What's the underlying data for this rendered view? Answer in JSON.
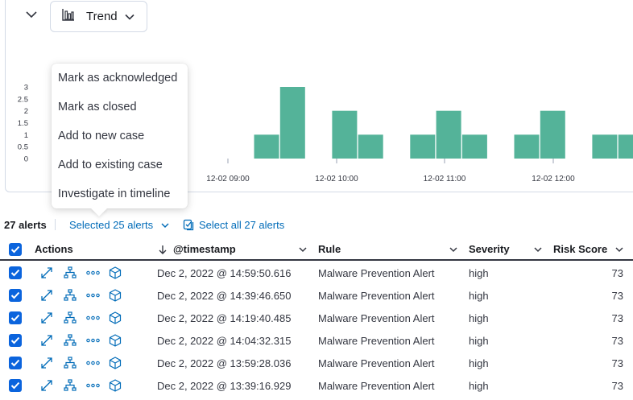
{
  "toolbar": {
    "trend_label": "Trend"
  },
  "chart_data": {
    "type": "bar",
    "y_ticks": [
      "3",
      "2.5",
      "2",
      "1.5",
      "1",
      "0.5",
      "0"
    ],
    "x_ticks": [
      "12-02 09:00",
      "12-02 10:00",
      "12-02 11:00",
      "12-02 12:00"
    ],
    "ylim": [
      0,
      3
    ],
    "values": [
      1,
      3,
      0,
      2,
      1,
      0,
      1,
      2,
      1,
      0,
      1,
      2,
      0,
      1,
      1
    ],
    "color": "#54b399"
  },
  "context_menu": {
    "items": [
      "Mark as acknowledged",
      "Mark as closed",
      "Add to new case",
      "Add to existing case",
      "Investigate in timeline"
    ]
  },
  "alerts_bar": {
    "count": "27 alerts",
    "selected": "Selected 25 alerts",
    "select_all": "Select all 27 alerts"
  },
  "table": {
    "columns": {
      "actions": "Actions",
      "timestamp": "@timestamp",
      "rule": "Rule",
      "severity": "Severity",
      "risk": "Risk Score"
    },
    "rows": [
      {
        "timestamp": "Dec 2, 2022 @ 14:59:50.616",
        "rule": "Malware Prevention Alert",
        "severity": "high",
        "risk": "73"
      },
      {
        "timestamp": "Dec 2, 2022 @ 14:39:46.650",
        "rule": "Malware Prevention Alert",
        "severity": "high",
        "risk": "73"
      },
      {
        "timestamp": "Dec 2, 2022 @ 14:19:40.485",
        "rule": "Malware Prevention Alert",
        "severity": "high",
        "risk": "73"
      },
      {
        "timestamp": "Dec 2, 2022 @ 14:04:32.315",
        "rule": "Malware Prevention Alert",
        "severity": "high",
        "risk": "73"
      },
      {
        "timestamp": "Dec 2, 2022 @ 13:59:28.036",
        "rule": "Malware Prevention Alert",
        "severity": "high",
        "risk": "73"
      },
      {
        "timestamp": "Dec 2, 2022 @ 13:39:16.929",
        "rule": "Malware Prevention Alert",
        "severity": "high",
        "risk": "73"
      }
    ]
  }
}
